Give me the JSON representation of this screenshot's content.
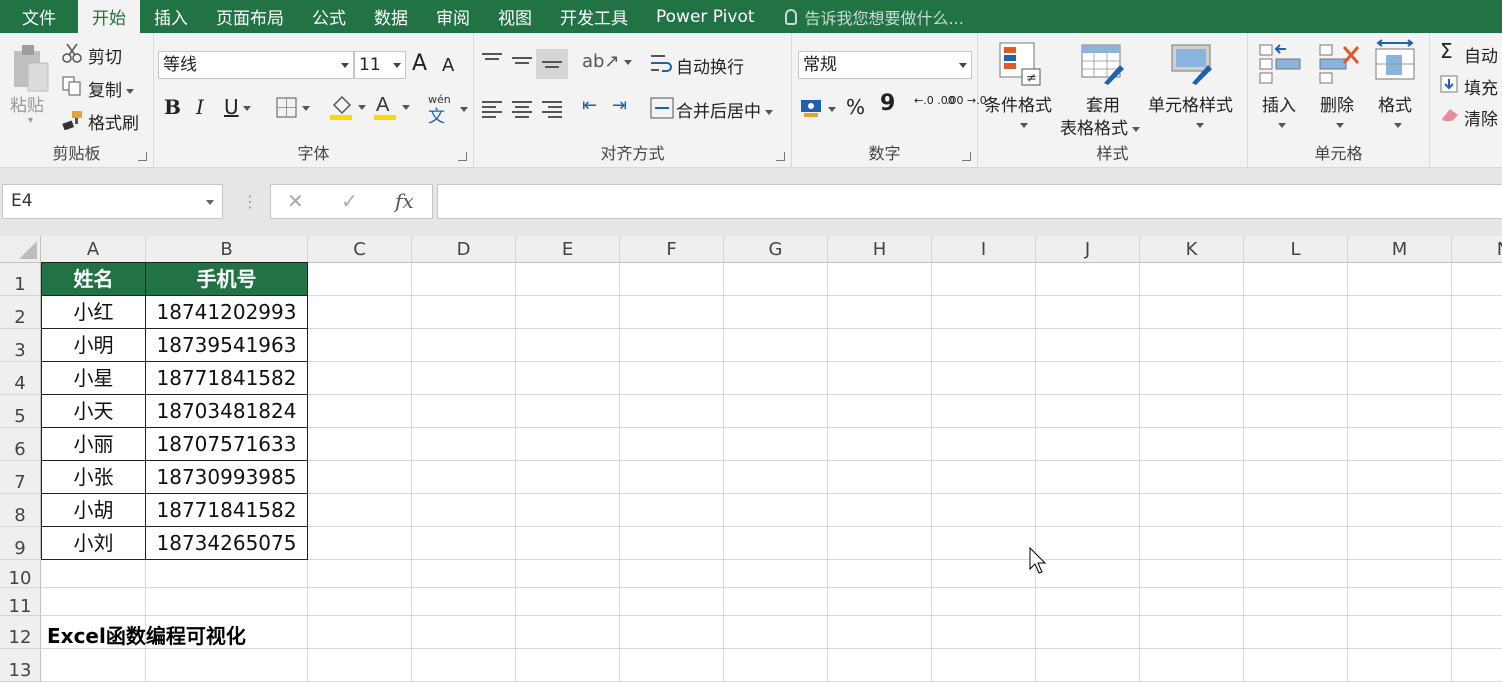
{
  "menu": {
    "items": [
      "文件",
      "开始",
      "插入",
      "页面布局",
      "公式",
      "数据",
      "审阅",
      "视图",
      "开发工具",
      "Power Pivot"
    ],
    "active": "开始",
    "tellme": "告诉我您想要做什么..."
  },
  "ribbon": {
    "clipboard": {
      "paste": "粘贴",
      "cut": "剪切",
      "copy": "复制",
      "format_painter": "格式刷",
      "label": "剪贴板"
    },
    "font": {
      "font_name": "等线",
      "font_size": "11",
      "grow": "A",
      "shrink": "A",
      "bold": "B",
      "italic": "I",
      "underline": "U",
      "phonetic_top": "wén",
      "phonetic_bottom": "文",
      "label": "字体"
    },
    "alignment": {
      "wrap_text": "自动换行",
      "merge_center": "合并后居中",
      "label": "对齐方式"
    },
    "number": {
      "format": "常规",
      "percent": "%",
      "comma": "9",
      "inc_decimal": "←.0 .00",
      "dec_decimal": ".00 →.0",
      "label": "数字"
    },
    "styles": {
      "conditional": "条件格式",
      "table_format_line1": "套用",
      "table_format_line2": "表格格式",
      "cell_styles": "单元格样式",
      "label": "样式"
    },
    "cells": {
      "insert": "插入",
      "delete": "删除",
      "format": "格式",
      "label": "单元格"
    },
    "editing": {
      "autosum": "自动",
      "fill": "填充",
      "clear": "清除",
      "sigma": "Σ"
    }
  },
  "formula_bar": {
    "name_box": "E4",
    "fx": "fx",
    "cancel": "✕",
    "enter": "✓",
    "value": ""
  },
  "sheet": {
    "columns": [
      "A",
      "B",
      "C",
      "D",
      "E",
      "F",
      "G",
      "H",
      "I",
      "J",
      "K",
      "L",
      "M",
      "N"
    ],
    "rows": [
      "1",
      "2",
      "3",
      "4",
      "5",
      "6",
      "7",
      "8",
      "9",
      "10",
      "11",
      "12",
      "13"
    ],
    "header": [
      "姓名",
      "手机号"
    ],
    "data": [
      [
        "小红",
        "18741202993"
      ],
      [
        "小明",
        "18739541963"
      ],
      [
        "小星",
        "18771841582"
      ],
      [
        "小天",
        "18703481824"
      ],
      [
        "小丽",
        "18707571633"
      ],
      [
        "小张",
        "18730993985"
      ],
      [
        "小胡",
        "18771841582"
      ],
      [
        "小刘",
        "18734265075"
      ]
    ],
    "note": "Excel函数编程可视化",
    "header_color": "#217346"
  },
  "colors": {
    "accent": "#217346",
    "font_highlight": "#ffd800",
    "font_color": "#ffd800"
  }
}
